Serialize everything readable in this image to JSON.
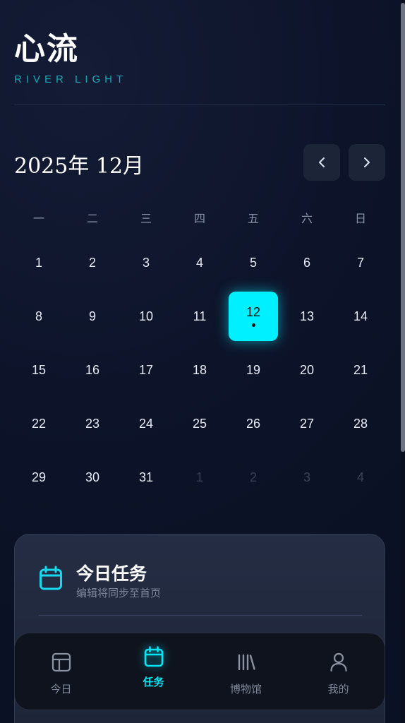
{
  "header": {
    "title": "心流",
    "subtitle": "RIVER LIGHT"
  },
  "calendar": {
    "month_label": "2025年 12月",
    "weekdays": [
      "一",
      "二",
      "三",
      "四",
      "五",
      "六",
      "日"
    ],
    "days": [
      {
        "n": "1"
      },
      {
        "n": "2"
      },
      {
        "n": "3"
      },
      {
        "n": "4"
      },
      {
        "n": "5"
      },
      {
        "n": "6"
      },
      {
        "n": "7"
      },
      {
        "n": "8"
      },
      {
        "n": "9"
      },
      {
        "n": "10"
      },
      {
        "n": "11"
      },
      {
        "n": "12",
        "selected": true,
        "has_task": true
      },
      {
        "n": "13"
      },
      {
        "n": "14"
      },
      {
        "n": "15"
      },
      {
        "n": "16"
      },
      {
        "n": "17"
      },
      {
        "n": "18"
      },
      {
        "n": "19"
      },
      {
        "n": "20"
      },
      {
        "n": "21"
      },
      {
        "n": "22"
      },
      {
        "n": "23"
      },
      {
        "n": "24"
      },
      {
        "n": "25"
      },
      {
        "n": "26"
      },
      {
        "n": "27"
      },
      {
        "n": "28"
      },
      {
        "n": "29"
      },
      {
        "n": "30"
      },
      {
        "n": "31"
      },
      {
        "n": "1",
        "muted": true
      },
      {
        "n": "2",
        "muted": true
      },
      {
        "n": "3",
        "muted": true
      },
      {
        "n": "4",
        "muted": true
      }
    ],
    "prev_icon": "chevron-left-icon",
    "next_icon": "chevron-right-icon"
  },
  "task_card": {
    "icon": "calendar-icon",
    "title": "今日任务",
    "subtitle": "编辑将同步至首页"
  },
  "tabbar": {
    "tabs": [
      {
        "id": "today",
        "label": "今日",
        "icon": "layout-icon",
        "active": false
      },
      {
        "id": "tasks",
        "label": "任务",
        "icon": "calendar-icon",
        "active": true
      },
      {
        "id": "museum",
        "label": "博物馆",
        "icon": "library-icon",
        "active": false
      },
      {
        "id": "me",
        "label": "我的",
        "icon": "user-icon",
        "active": false
      }
    ]
  },
  "colors": {
    "accent": "#00f0ff",
    "background": "#0d142a",
    "muted_text": "#8892a6"
  }
}
